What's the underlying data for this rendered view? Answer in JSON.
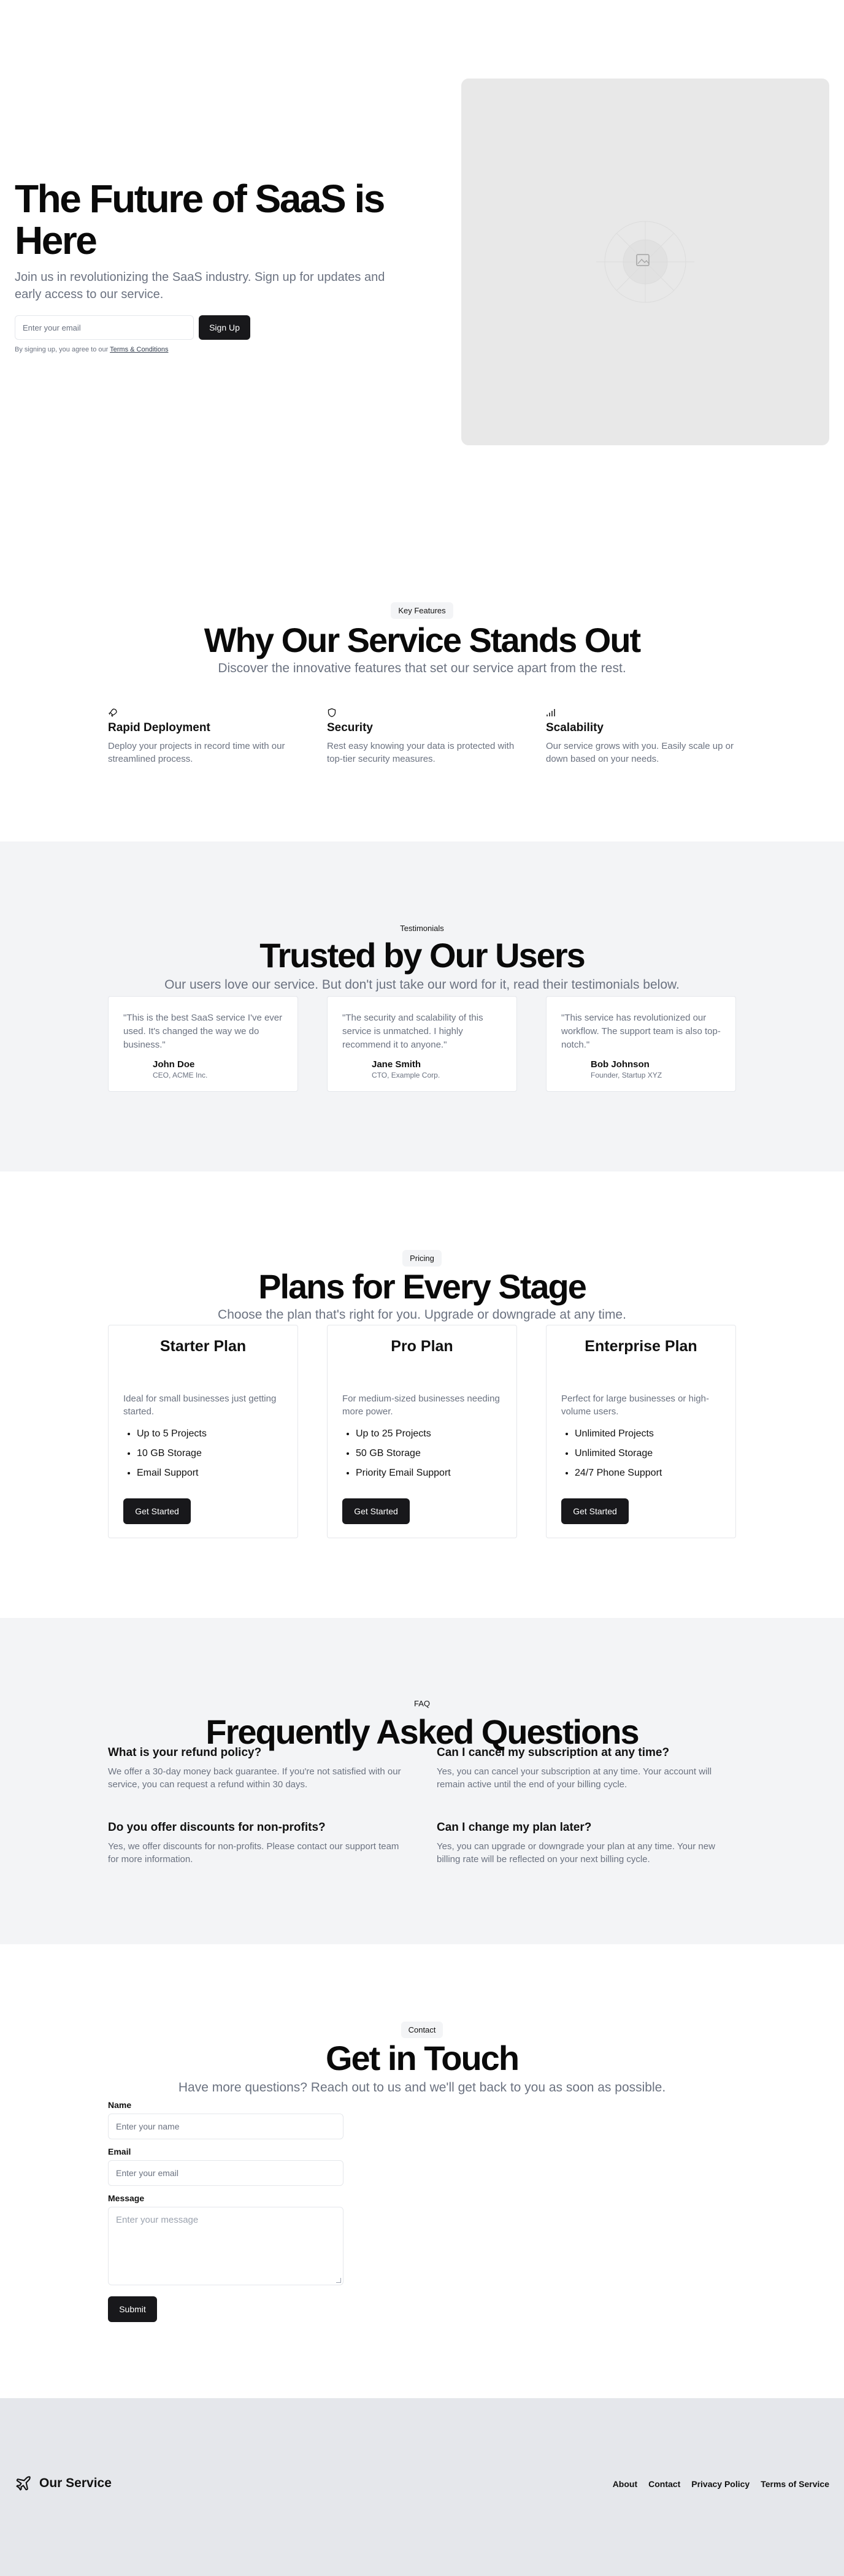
{
  "hero": {
    "title": "The Future of SaaS is Here",
    "subtitle": "Join us in revolutionizing the SaaS industry. Sign up for updates and early access to our service.",
    "email_placeholder": "Enter your email",
    "signup_label": "Sign Up",
    "terms_prefix": "By signing up, you agree to our",
    "terms_link": "Terms & Conditions",
    "image_icon": "image-placeholder-icon"
  },
  "features": {
    "badge": "Key Features",
    "title": "Why Our Service Stands Out",
    "subtitle": "Discover the innovative features that set our service apart from the rest.",
    "items": [
      {
        "icon": "rocket-icon",
        "title": "Rapid Deployment",
        "desc": "Deploy your projects in record time with our streamlined process."
      },
      {
        "icon": "shield-icon",
        "title": "Security",
        "desc": "Rest easy knowing your data is protected with top-tier security measures."
      },
      {
        "icon": "bar-chart-icon",
        "title": "Scalability",
        "desc": "Our service grows with you. Easily scale up or down based on your needs."
      }
    ]
  },
  "testimonials": {
    "badge": "Testimonials",
    "title": "Trusted by Our Users",
    "subtitle": "Our users love our service. But don't just take our word for it, read their testimonials below.",
    "items": [
      {
        "quote": "\"This is the best SaaS service I've ever used. It's changed the way we do business.\"",
        "name": "John Doe",
        "role": "CEO, ACME Inc."
      },
      {
        "quote": "\"The security and scalability of this service is unmatched. I highly recommend it to anyone.\"",
        "name": "Jane Smith",
        "role": "CTO, Example Corp."
      },
      {
        "quote": "\"This service has revolutionized our workflow. The support team is also top-notch.\"",
        "name": "Bob Johnson",
        "role": "Founder, Startup XYZ"
      }
    ]
  },
  "pricing": {
    "badge": "Pricing",
    "title": "Plans for Every Stage",
    "subtitle": "Choose the plan that's right for you. Upgrade or downgrade at any time.",
    "plans": [
      {
        "name": "Starter Plan",
        "desc": "Ideal for small businesses just getting started.",
        "features": [
          "Up to 5 Projects",
          "10 GB Storage",
          "Email Support"
        ],
        "cta": "Get Started"
      },
      {
        "name": "Pro Plan",
        "desc": "For medium-sized businesses needing more power.",
        "features": [
          "Up to 25 Projects",
          "50 GB Storage",
          "Priority Email Support"
        ],
        "cta": "Get Started"
      },
      {
        "name": "Enterprise Plan",
        "desc": "Perfect for large businesses or high-volume users.",
        "features": [
          "Unlimited Projects",
          "Unlimited Storage",
          "24/7 Phone Support"
        ],
        "cta": "Get Started"
      }
    ]
  },
  "faq": {
    "badge": "FAQ",
    "title": "Frequently Asked Questions",
    "items": [
      {
        "q": "What is your refund policy?",
        "a": "We offer a 30-day money back guarantee. If you're not satisfied with our service, you can request a refund within 30 days."
      },
      {
        "q": "Can I cancel my subscription at any time?",
        "a": "Yes, you can cancel your subscription at any time. Your account will remain active until the end of your billing cycle."
      },
      {
        "q": "Do you offer discounts for non-profits?",
        "a": "Yes, we offer discounts for non-profits. Please contact our support team for more information."
      },
      {
        "q": "Can I change my plan later?",
        "a": "Yes, you can upgrade or downgrade your plan at any time. Your new billing rate will be reflected on your next billing cycle."
      }
    ]
  },
  "contact": {
    "badge": "Contact",
    "title": "Get in Touch",
    "subtitle": "Have more questions? Reach out to us and we'll get back to you as soon as possible.",
    "name_label": "Name",
    "name_placeholder": "Enter your name",
    "email_label": "Email",
    "email_placeholder": "Enter your email",
    "message_label": "Message",
    "message_placeholder": "Enter your message",
    "submit_label": "Submit"
  },
  "footer": {
    "brand": "Our Service",
    "logo_icon": "plane-icon",
    "links": [
      "About",
      "Contact",
      "Privacy Policy",
      "Terms of Service"
    ]
  },
  "colors": {
    "primary": "#18181b",
    "muted_text": "#6b7280",
    "section_gray": "#f3f4f6",
    "footer_gray": "#e5e7eb"
  }
}
